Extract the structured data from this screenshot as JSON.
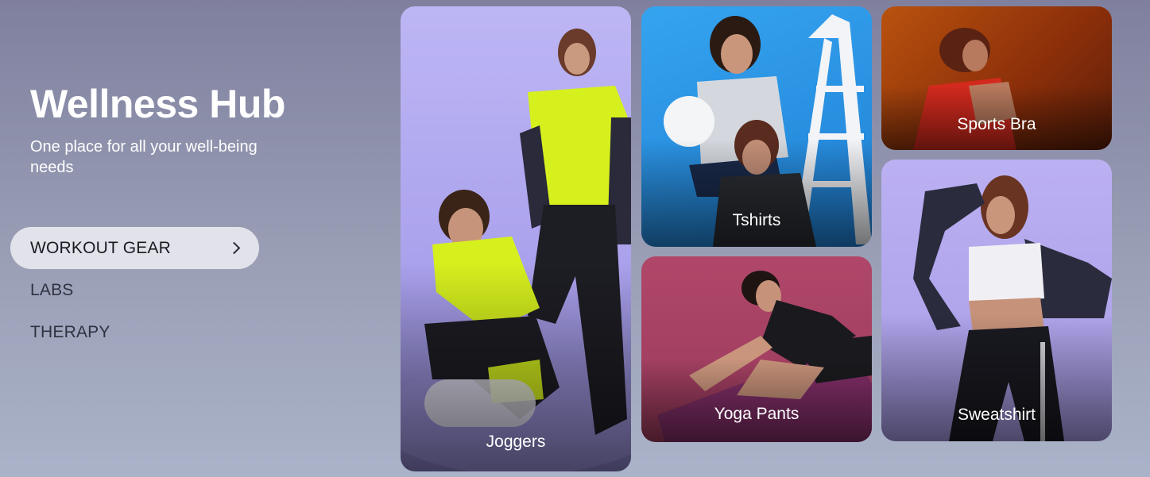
{
  "hero": {
    "title": "Wellness Hub",
    "subtitle": "One place for all your well-being needs"
  },
  "nav": {
    "items": [
      {
        "label": "WORKOUT GEAR",
        "active": true
      },
      {
        "label": "LABS",
        "active": false
      },
      {
        "label": "THERAPY",
        "active": false
      }
    ]
  },
  "categories": [
    {
      "label": "Joggers",
      "bg": "#b9b2f0"
    },
    {
      "label": "Tshirts",
      "bg": "#2a8fe0"
    },
    {
      "label": "Sports Bra",
      "bg": "#9a3a0c"
    },
    {
      "label": "Yoga Pants",
      "bg": "#a8405e"
    },
    {
      "label": "Sweatshirt",
      "bg": "#b4a8ee"
    }
  ],
  "colors": {
    "accent_lime": "#d6f01e",
    "nav_active_bg": "#e2e3ea"
  }
}
